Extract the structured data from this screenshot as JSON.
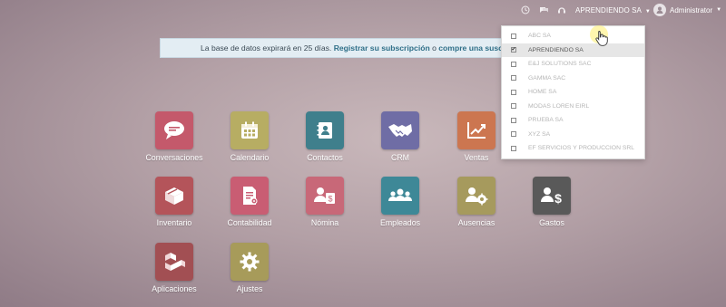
{
  "topbar": {
    "company": "APRENDIENDO SA",
    "user": "Administrator"
  },
  "banner": {
    "prefix": "La base de datos expirará en 25 días.",
    "register": "Registrar su subscripción",
    "middle": "o",
    "buy": "compre una suscri"
  },
  "apps": [
    {
      "label": "Conversaciones",
      "color": "#c4596b",
      "icon": "chat-icon"
    },
    {
      "label": "Calendario",
      "color": "#b7ad63",
      "icon": "calendar-icon"
    },
    {
      "label": "Contactos",
      "color": "#3f7f8c",
      "icon": "contacts-icon"
    },
    {
      "label": "CRM",
      "color": "#6f6da5",
      "icon": "handshake-icon"
    },
    {
      "label": "Ventas",
      "color": "#cc7650",
      "icon": "chart-icon"
    },
    {
      "label": "Inventario",
      "color": "#b4545a",
      "icon": "box-icon"
    },
    {
      "label": "Contabilidad",
      "color": "#c95d73",
      "icon": "invoice-icon"
    },
    {
      "label": "Nómina",
      "color": "#c86878",
      "icon": "payroll-icon"
    },
    {
      "label": "Empleados",
      "color": "#3e8897",
      "icon": "employees-icon"
    },
    {
      "label": "Ausencias",
      "color": "#a69a5d",
      "icon": "absences-icon"
    },
    {
      "label": "Gastos",
      "color": "#595959",
      "icon": "expenses-icon"
    },
    {
      "label": "Aplicaciones",
      "color": "#a24f53",
      "icon": "apps-icon"
    },
    {
      "label": "Ajustes",
      "color": "#a79b5a",
      "icon": "gear-icon"
    }
  ],
  "companies": [
    {
      "name": "ABC SA",
      "checked": false
    },
    {
      "name": "APRENDIENDO SA",
      "checked": true
    },
    {
      "name": "E&J SOLUTIONS SAC",
      "checked": false
    },
    {
      "name": "GAMMA SAC",
      "checked": false
    },
    {
      "name": "HOME SA",
      "checked": false
    },
    {
      "name": "MODAS LOREN EIRL",
      "checked": false
    },
    {
      "name": "PRUEBA SA",
      "checked": false
    },
    {
      "name": "XYZ SA",
      "checked": false
    },
    {
      "name": "EF SERVICIOS Y PRODUCCION SRL",
      "checked": false
    }
  ]
}
